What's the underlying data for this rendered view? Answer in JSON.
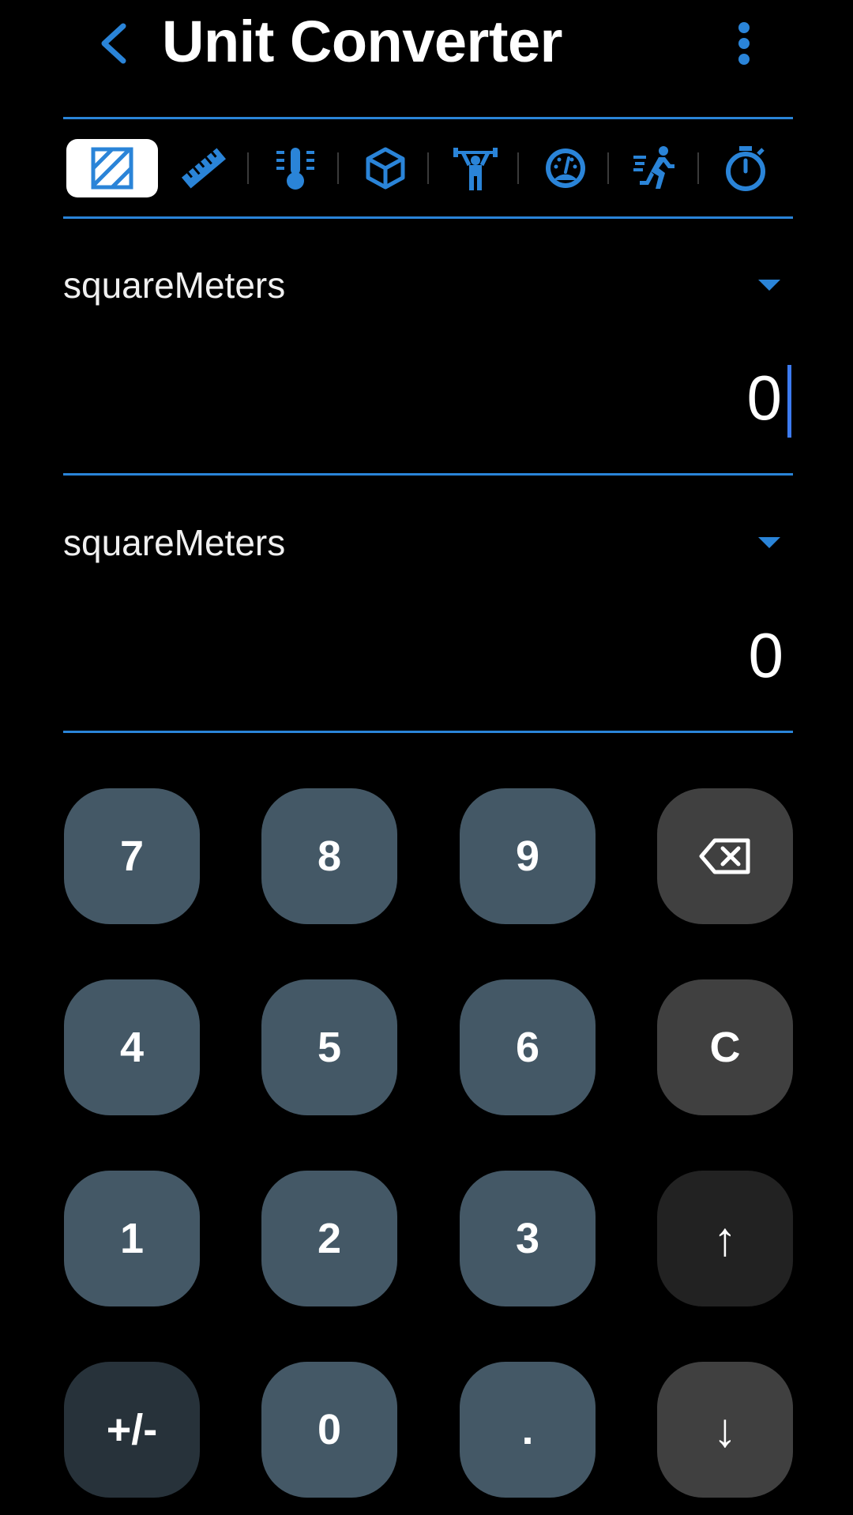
{
  "header": {
    "title": "Unit Converter",
    "back_icon": "chevron-left-icon",
    "menu_icon": "more-vertical-icon"
  },
  "tabs": [
    {
      "icon": "area-icon",
      "active": true
    },
    {
      "icon": "ruler-icon",
      "active": false
    },
    {
      "icon": "thermometer-icon",
      "active": false
    },
    {
      "icon": "cube-icon",
      "active": false
    },
    {
      "icon": "weightlifter-icon",
      "active": false
    },
    {
      "icon": "speedometer-icon",
      "active": false
    },
    {
      "icon": "runner-icon",
      "active": false
    },
    {
      "icon": "stopwatch-icon",
      "active": false
    }
  ],
  "from": {
    "unit": "squareMeters",
    "value": "0"
  },
  "to": {
    "unit": "squareMeters",
    "value": "0"
  },
  "keypad": {
    "rows": [
      [
        "7",
        "8",
        "9",
        "⌫"
      ],
      [
        "4",
        "5",
        "6",
        "C"
      ],
      [
        "1",
        "2",
        "3",
        "↑"
      ],
      [
        "+/-",
        "0",
        ".",
        "↓"
      ]
    ],
    "backspace_icon": "backspace-icon"
  },
  "colors": {
    "accent": "#2a84d8",
    "background": "#000000",
    "number_key": "#445866",
    "operator_key": "#404040",
    "up_key": "#222222",
    "sign_key": "#27323a",
    "cursor": "#3d7bf0"
  }
}
